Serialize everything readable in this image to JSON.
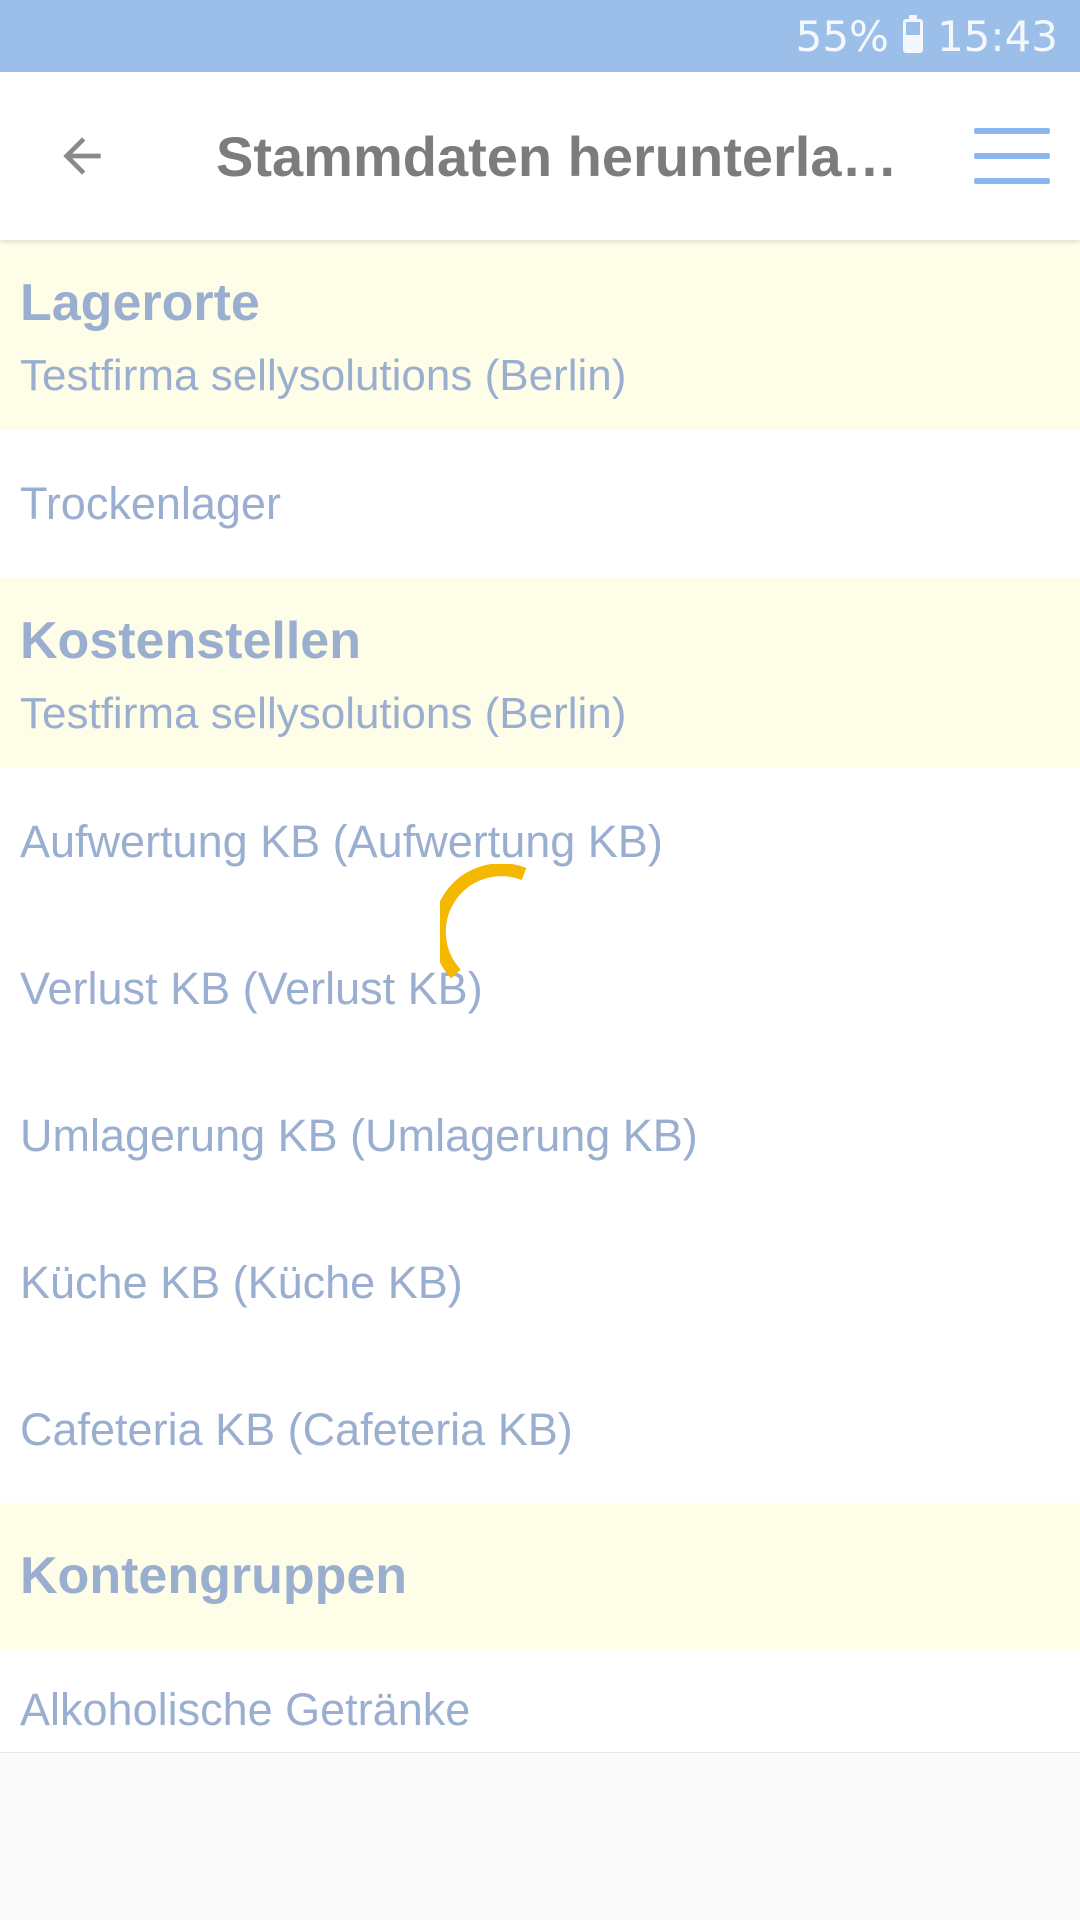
{
  "status_bar": {
    "battery": "55%",
    "battery_level": 0.55,
    "time": "15:43",
    "icons": [
      "battery-icon"
    ]
  },
  "app_bar": {
    "title": "Stammdaten herunterla…",
    "back_icon": "back-arrow-icon",
    "menu_icon": "hamburger-menu-icon"
  },
  "sections": [
    {
      "title": "Lagerorte",
      "subtitle": "Testfirma sellysolutions (Berlin)",
      "items": [
        "Trockenlager"
      ]
    },
    {
      "title": "Kostenstellen",
      "subtitle": "Testfirma sellysolutions (Berlin)",
      "items": [
        "Aufwertung KB (Aufwertung KB)",
        "Verlust KB (Verlust KB)",
        "Umlagerung KB (Umlagerung KB)",
        "Küche KB (Küche KB)",
        "Cafeteria KB (Cafeteria KB)"
      ]
    },
    {
      "title": "Kontengruppen",
      "items": [
        "Alkoholische Getränke"
      ]
    }
  ],
  "colors": {
    "status_bar": "#9bbfe8",
    "section_header_bg": "#fefde8",
    "text_accent": "#9aaed0",
    "spinner": "#f5b800",
    "menu_icon": "#8ab8ee"
  }
}
